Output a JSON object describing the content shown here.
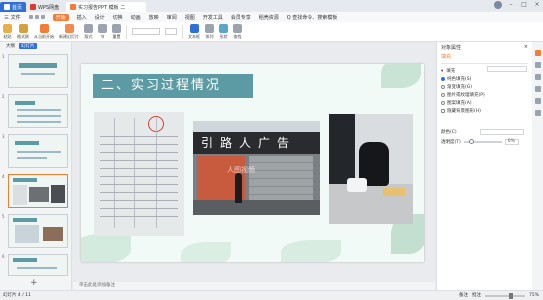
{
  "titlebar": {
    "tabs": [
      {
        "label": "首页"
      },
      {
        "label": "WPS网盘"
      },
      {
        "label": "实习报告PPT 模板 二"
      }
    ],
    "controls": [
      "–",
      "□",
      "×"
    ]
  },
  "menubar": {
    "items": [
      "三 文件",
      "开始",
      "插入",
      "设计",
      "切换",
      "动画",
      "放映",
      "审阅",
      "视图",
      "开发工具",
      "会员专享",
      "稻壳资源",
      "Q 查找命令、搜索模板"
    ],
    "active_index": 1
  },
  "ribbon": {
    "buttons": [
      "粘贴",
      "格式刷",
      "从当前开始",
      "新建幻灯片",
      "版式",
      "节",
      "重置",
      "文本框",
      "排列",
      "形状",
      "查找"
    ],
    "colors": {
      "primary": "#2f6fd6",
      "accent": "#f47d36"
    }
  },
  "leftpane": {
    "tabs": [
      "大纲",
      "幻灯片"
    ],
    "active_tab": 1,
    "slide_numbers": [
      "1",
      "2",
      "3",
      "4",
      "5",
      "6"
    ],
    "selected_slide": 4,
    "add_label": "+"
  },
  "slide": {
    "heading": "二、实习过程情况",
    "sign_text": "引路人广告",
    "watermark": "人图视频"
  },
  "notes": {
    "placeholder": "单击此处添加备注"
  },
  "rightpane": {
    "title": "对象属性",
    "tab": "填充",
    "fill_heading": "填充",
    "fill_options": [
      {
        "label": "纯色填充(S)",
        "checked": true
      },
      {
        "label": "渐变填充(G)",
        "checked": false
      },
      {
        "label": "图片或纹理填充(P)",
        "checked": false
      },
      {
        "label": "图案填充(A)",
        "checked": false
      },
      {
        "label": "隐藏背景图形(H)",
        "checked": false
      }
    ],
    "color_label": "颜色(C)",
    "transparency_label": "透明度(T)",
    "transparency_value": "0%",
    "transparency_level": 0.15
  },
  "statusbar": {
    "left": "幻灯片 4 / 11",
    "right": [
      "备注",
      "批注",
      "75%"
    ],
    "zoom_value": 75
  }
}
